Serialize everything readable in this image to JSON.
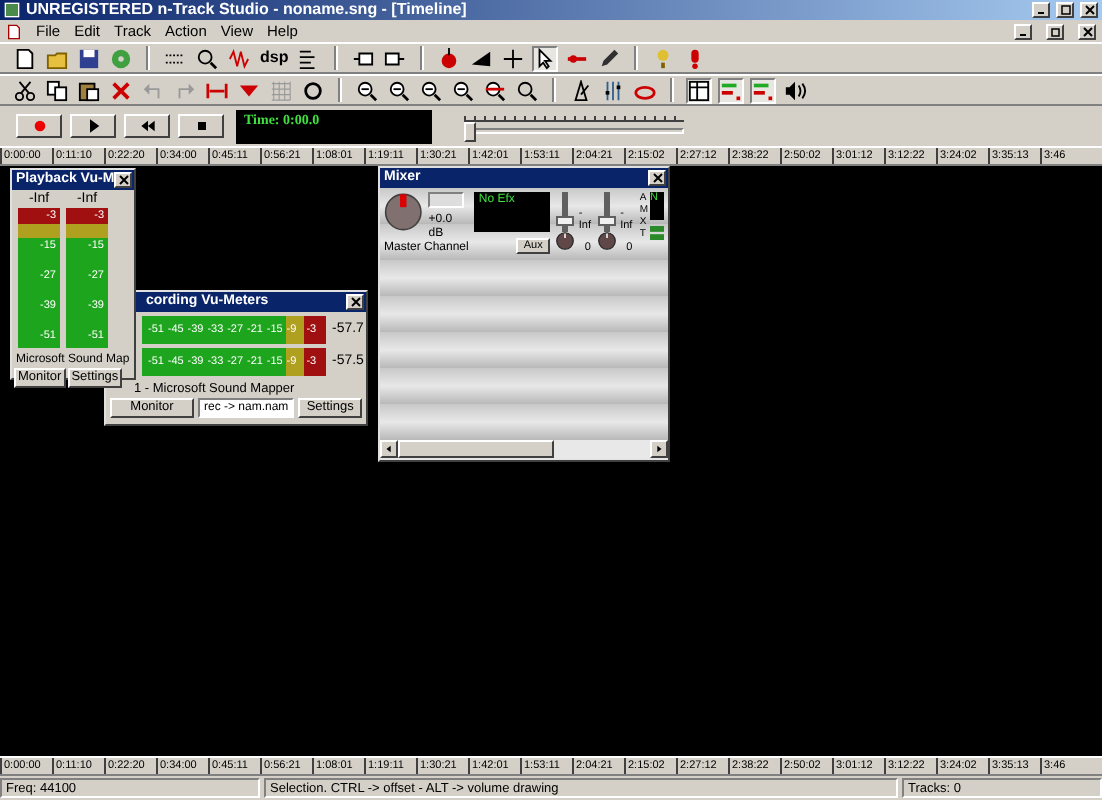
{
  "window": {
    "title": "UNREGISTERED n-Track Studio - noname.sng - [Timeline]"
  },
  "menu": [
    {
      "label": "File"
    },
    {
      "label": "Edit"
    },
    {
      "label": "Track"
    },
    {
      "label": "Action"
    },
    {
      "label": "View"
    },
    {
      "label": "Help"
    }
  ],
  "toolbar": {
    "dsp_label": "dsp"
  },
  "transport": {
    "time": "Time: 0:00.0",
    "position": {
      "level": 0.0
    }
  },
  "ruler": {
    "labels": [
      "0:00:00",
      "0:11:10",
      "0:22:20",
      "0:34:00",
      "0:45:11",
      "0:56:21",
      "1:08:01",
      "1:19:11",
      "1:30:21",
      "1:42:01",
      "1:53:11",
      "2:04:21",
      "2:15:02",
      "2:27:12",
      "2:38:22",
      "2:50:02",
      "3:01:12",
      "3:12:22",
      "3:24:02",
      "3:35:13",
      "3:46"
    ]
  },
  "playback_vu": {
    "title": "Playback Vu-M",
    "meters": [
      {
        "peak": "-Inf",
        "scale": [
          "-3",
          "-15",
          "-27",
          "-39",
          "-51"
        ]
      },
      {
        "peak": "-Inf",
        "scale": [
          "-3",
          "-15",
          "-27",
          "-39",
          "-51"
        ]
      }
    ],
    "device": "Microsoft Sound Map",
    "buttons": [
      "Monitor",
      "Settings"
    ]
  },
  "recording_vu": {
    "title": "cording Vu-Meters",
    "meters": [
      {
        "scale": [
          "-51",
          "-45",
          "-39",
          "-33",
          "-27",
          "-21",
          "-15",
          "-9",
          "-3"
        ],
        "reading": "-57.7"
      },
      {
        "scale": [
          "-51",
          "-45",
          "-39",
          "-33",
          "-27",
          "-21",
          "-15",
          "-9",
          "-3"
        ],
        "reading": "-57.5"
      }
    ],
    "device": "1 - Microsoft Sound Mapper",
    "monitor_button": "Monitor",
    "output_file": "rec -> nam.nam",
    "settings_button": "Settings"
  },
  "mixer": {
    "title": "Mixer",
    "gain": "+0.0 dB",
    "effects": "No Efx",
    "channel": "Master Channel",
    "aux_button": "Aux",
    "faders": [
      {
        "reading": "-Inf",
        "pan": "0",
        "level": 0.2
      },
      {
        "reading": "-Inf",
        "pan": "0",
        "level": 0.2
      }
    ],
    "side_labels": [
      "A",
      "M",
      "X",
      "T"
    ],
    "side_display": "N"
  },
  "bottom_ruler": {
    "labels": [
      "0:00:00",
      "0:11:10",
      "0:22:20",
      "0:34:00",
      "0:45:11",
      "0:56:21",
      "1:08:01",
      "1:19:11",
      "1:30:21",
      "1:42:01",
      "1:53:11",
      "2:04:21",
      "2:15:02",
      "2:27:12",
      "2:38:22",
      "2:50:02",
      "3:01:12",
      "3:12:22",
      "3:24:02",
      "3:35:13",
      "3:46"
    ]
  },
  "status_bar": [
    {
      "text": "Freq: 44100"
    },
    {
      "text": "Selection. CTRL -> offset - ALT -> volume drawing"
    },
    {
      "text": "Tracks: 0"
    }
  ]
}
